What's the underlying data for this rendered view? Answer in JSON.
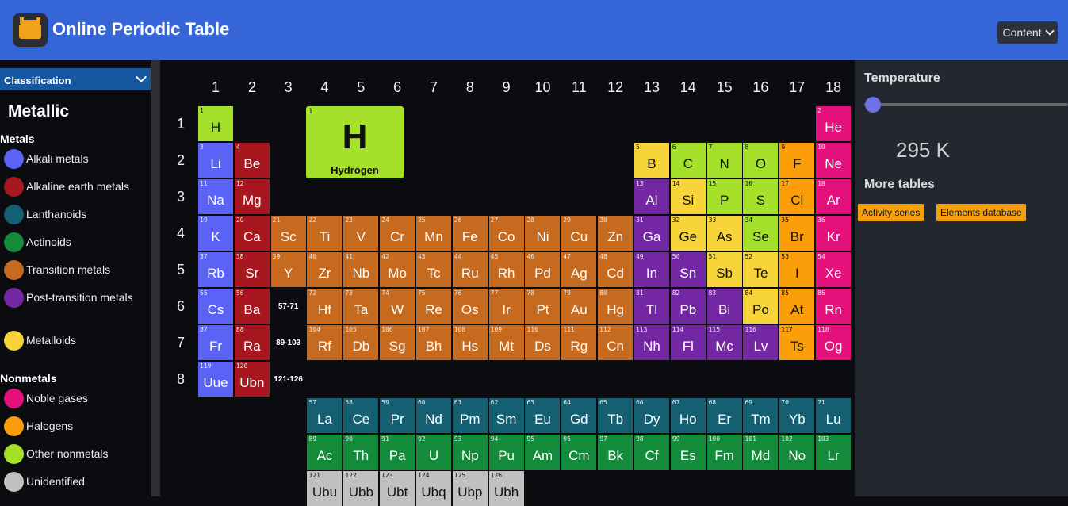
{
  "app": {
    "title": "Online Periodic Table",
    "logo_icon": "periodic-table-logo-icon",
    "content_menu": "Content"
  },
  "sidebar": {
    "classification_select": "Classification",
    "heading": "Metallic",
    "groups": [
      {
        "label": "Metals",
        "items": [
          {
            "label": "Alkali metals",
            "color": "#5a63f5"
          },
          {
            "label": "Alkaline earth metals",
            "color": "#a8171f"
          },
          {
            "label": "Lanthanoids",
            "color": "#155f73"
          },
          {
            "label": "Actinoids",
            "color": "#148a3b"
          },
          {
            "label": "Transition metals",
            "color": "#c56a1f"
          },
          {
            "label": "Post-transition metals",
            "color": "#7427a3"
          },
          {
            "label": "Metalloids",
            "color": "#f7d53a"
          }
        ]
      },
      {
        "label": "Nonmetals",
        "items": [
          {
            "label": "Noble gases",
            "color": "#e4117c"
          },
          {
            "label": "Halogens",
            "color": "#fb9e0a"
          },
          {
            "label": "Other nonmetals",
            "color": "#a5e12a"
          },
          {
            "label": "Unidentified",
            "color": "#c0c0c0"
          }
        ]
      }
    ]
  },
  "table": {
    "group_labels": [
      "1",
      "2",
      "3",
      "4",
      "5",
      "6",
      "7",
      "8",
      "9",
      "10",
      "11",
      "12",
      "13",
      "14",
      "15",
      "16",
      "17",
      "18"
    ],
    "period_labels": [
      "1",
      "2",
      "3",
      "4",
      "5",
      "6",
      "7",
      "8"
    ],
    "range_labels": [
      "57-71",
      "89-103",
      "121-126"
    ],
    "featured": {
      "number": "1",
      "symbol": "H",
      "name": "Hydrogen"
    },
    "category_colors": {
      "alkali": "#5a63f5",
      "alkaline": "#a8171f",
      "lanthanoid": "#155f73",
      "actinoid": "#148a3b",
      "transition": "#c56a1f",
      "post": "#7427a3",
      "metalloid": "#f7d53a",
      "noble": "#e4117c",
      "halogen": "#fb9e0a",
      "nonmetal": "#a5e12a",
      "unknown": "#c0c0c0"
    },
    "elements": [
      {
        "n": "1",
        "s": "H",
        "p": 1,
        "g": 1,
        "c": "nonmetal"
      },
      {
        "n": "2",
        "s": "He",
        "p": 1,
        "g": 18,
        "c": "noble"
      },
      {
        "n": "3",
        "s": "Li",
        "p": 2,
        "g": 1,
        "c": "alkali"
      },
      {
        "n": "4",
        "s": "Be",
        "p": 2,
        "g": 2,
        "c": "alkaline"
      },
      {
        "n": "5",
        "s": "B",
        "p": 2,
        "g": 13,
        "c": "metalloid"
      },
      {
        "n": "6",
        "s": "C",
        "p": 2,
        "g": 14,
        "c": "nonmetal"
      },
      {
        "n": "7",
        "s": "N",
        "p": 2,
        "g": 15,
        "c": "nonmetal"
      },
      {
        "n": "8",
        "s": "O",
        "p": 2,
        "g": 16,
        "c": "nonmetal"
      },
      {
        "n": "9",
        "s": "F",
        "p": 2,
        "g": 17,
        "c": "halogen"
      },
      {
        "n": "10",
        "s": "Ne",
        "p": 2,
        "g": 18,
        "c": "noble"
      },
      {
        "n": "11",
        "s": "Na",
        "p": 3,
        "g": 1,
        "c": "alkali"
      },
      {
        "n": "12",
        "s": "Mg",
        "p": 3,
        "g": 2,
        "c": "alkaline"
      },
      {
        "n": "13",
        "s": "Al",
        "p": 3,
        "g": 13,
        "c": "post"
      },
      {
        "n": "14",
        "s": "Si",
        "p": 3,
        "g": 14,
        "c": "metalloid"
      },
      {
        "n": "15",
        "s": "P",
        "p": 3,
        "g": 15,
        "c": "nonmetal"
      },
      {
        "n": "16",
        "s": "S",
        "p": 3,
        "g": 16,
        "c": "nonmetal"
      },
      {
        "n": "17",
        "s": "Cl",
        "p": 3,
        "g": 17,
        "c": "halogen"
      },
      {
        "n": "18",
        "s": "Ar",
        "p": 3,
        "g": 18,
        "c": "noble"
      },
      {
        "n": "19",
        "s": "K",
        "p": 4,
        "g": 1,
        "c": "alkali"
      },
      {
        "n": "20",
        "s": "Ca",
        "p": 4,
        "g": 2,
        "c": "alkaline"
      },
      {
        "n": "21",
        "s": "Sc",
        "p": 4,
        "g": 3,
        "c": "transition"
      },
      {
        "n": "22",
        "s": "Ti",
        "p": 4,
        "g": 4,
        "c": "transition"
      },
      {
        "n": "23",
        "s": "V",
        "p": 4,
        "g": 5,
        "c": "transition"
      },
      {
        "n": "24",
        "s": "Cr",
        "p": 4,
        "g": 6,
        "c": "transition"
      },
      {
        "n": "25",
        "s": "Mn",
        "p": 4,
        "g": 7,
        "c": "transition"
      },
      {
        "n": "26",
        "s": "Fe",
        "p": 4,
        "g": 8,
        "c": "transition"
      },
      {
        "n": "27",
        "s": "Co",
        "p": 4,
        "g": 9,
        "c": "transition"
      },
      {
        "n": "28",
        "s": "Ni",
        "p": 4,
        "g": 10,
        "c": "transition"
      },
      {
        "n": "29",
        "s": "Cu",
        "p": 4,
        "g": 11,
        "c": "transition"
      },
      {
        "n": "30",
        "s": "Zn",
        "p": 4,
        "g": 12,
        "c": "transition"
      },
      {
        "n": "31",
        "s": "Ga",
        "p": 4,
        "g": 13,
        "c": "post"
      },
      {
        "n": "32",
        "s": "Ge",
        "p": 4,
        "g": 14,
        "c": "metalloid"
      },
      {
        "n": "33",
        "s": "As",
        "p": 4,
        "g": 15,
        "c": "metalloid"
      },
      {
        "n": "34",
        "s": "Se",
        "p": 4,
        "g": 16,
        "c": "nonmetal"
      },
      {
        "n": "35",
        "s": "Br",
        "p": 4,
        "g": 17,
        "c": "halogen"
      },
      {
        "n": "36",
        "s": "Kr",
        "p": 4,
        "g": 18,
        "c": "noble"
      },
      {
        "n": "37",
        "s": "Rb",
        "p": 5,
        "g": 1,
        "c": "alkali"
      },
      {
        "n": "38",
        "s": "Sr",
        "p": 5,
        "g": 2,
        "c": "alkaline"
      },
      {
        "n": "39",
        "s": "Y",
        "p": 5,
        "g": 3,
        "c": "transition"
      },
      {
        "n": "40",
        "s": "Zr",
        "p": 5,
        "g": 4,
        "c": "transition"
      },
      {
        "n": "41",
        "s": "Nb",
        "p": 5,
        "g": 5,
        "c": "transition"
      },
      {
        "n": "42",
        "s": "Mo",
        "p": 5,
        "g": 6,
        "c": "transition"
      },
      {
        "n": "43",
        "s": "Tc",
        "p": 5,
        "g": 7,
        "c": "transition"
      },
      {
        "n": "44",
        "s": "Ru",
        "p": 5,
        "g": 8,
        "c": "transition"
      },
      {
        "n": "45",
        "s": "Rh",
        "p": 5,
        "g": 9,
        "c": "transition"
      },
      {
        "n": "46",
        "s": "Pd",
        "p": 5,
        "g": 10,
        "c": "transition"
      },
      {
        "n": "47",
        "s": "Ag",
        "p": 5,
        "g": 11,
        "c": "transition"
      },
      {
        "n": "48",
        "s": "Cd",
        "p": 5,
        "g": 12,
        "c": "transition"
      },
      {
        "n": "49",
        "s": "In",
        "p": 5,
        "g": 13,
        "c": "post"
      },
      {
        "n": "50",
        "s": "Sn",
        "p": 5,
        "g": 14,
        "c": "post"
      },
      {
        "n": "51",
        "s": "Sb",
        "p": 5,
        "g": 15,
        "c": "metalloid"
      },
      {
        "n": "52",
        "s": "Te",
        "p": 5,
        "g": 16,
        "c": "metalloid"
      },
      {
        "n": "53",
        "s": "I",
        "p": 5,
        "g": 17,
        "c": "halogen"
      },
      {
        "n": "54",
        "s": "Xe",
        "p": 5,
        "g": 18,
        "c": "noble"
      },
      {
        "n": "55",
        "s": "Cs",
        "p": 6,
        "g": 1,
        "c": "alkali"
      },
      {
        "n": "56",
        "s": "Ba",
        "p": 6,
        "g": 2,
        "c": "alkaline"
      },
      {
        "n": "72",
        "s": "Hf",
        "p": 6,
        "g": 4,
        "c": "transition"
      },
      {
        "n": "73",
        "s": "Ta",
        "p": 6,
        "g": 5,
        "c": "transition"
      },
      {
        "n": "74",
        "s": "W",
        "p": 6,
        "g": 6,
        "c": "transition"
      },
      {
        "n": "75",
        "s": "Re",
        "p": 6,
        "g": 7,
        "c": "transition"
      },
      {
        "n": "76",
        "s": "Os",
        "p": 6,
        "g": 8,
        "c": "transition"
      },
      {
        "n": "77",
        "s": "Ir",
        "p": 6,
        "g": 9,
        "c": "transition"
      },
      {
        "n": "78",
        "s": "Pt",
        "p": 6,
        "g": 10,
        "c": "transition"
      },
      {
        "n": "79",
        "s": "Au",
        "p": 6,
        "g": 11,
        "c": "transition"
      },
      {
        "n": "80",
        "s": "Hg",
        "p": 6,
        "g": 12,
        "c": "transition"
      },
      {
        "n": "81",
        "s": "Tl",
        "p": 6,
        "g": 13,
        "c": "post"
      },
      {
        "n": "82",
        "s": "Pb",
        "p": 6,
        "g": 14,
        "c": "post"
      },
      {
        "n": "83",
        "s": "Bi",
        "p": 6,
        "g": 15,
        "c": "post"
      },
      {
        "n": "84",
        "s": "Po",
        "p": 6,
        "g": 16,
        "c": "metalloid"
      },
      {
        "n": "85",
        "s": "At",
        "p": 6,
        "g": 17,
        "c": "halogen"
      },
      {
        "n": "86",
        "s": "Rn",
        "p": 6,
        "g": 18,
        "c": "noble"
      },
      {
        "n": "87",
        "s": "Fr",
        "p": 7,
        "g": 1,
        "c": "alkali"
      },
      {
        "n": "88",
        "s": "Ra",
        "p": 7,
        "g": 2,
        "c": "alkaline"
      },
      {
        "n": "104",
        "s": "Rf",
        "p": 7,
        "g": 4,
        "c": "transition"
      },
      {
        "n": "105",
        "s": "Db",
        "p": 7,
        "g": 5,
        "c": "transition"
      },
      {
        "n": "106",
        "s": "Sg",
        "p": 7,
        "g": 6,
        "c": "transition"
      },
      {
        "n": "107",
        "s": "Bh",
        "p": 7,
        "g": 7,
        "c": "transition"
      },
      {
        "n": "108",
        "s": "Hs",
        "p": 7,
        "g": 8,
        "c": "transition"
      },
      {
        "n": "109",
        "s": "Mt",
        "p": 7,
        "g": 9,
        "c": "transition"
      },
      {
        "n": "110",
        "s": "Ds",
        "p": 7,
        "g": 10,
        "c": "transition"
      },
      {
        "n": "111",
        "s": "Rg",
        "p": 7,
        "g": 11,
        "c": "transition"
      },
      {
        "n": "112",
        "s": "Cn",
        "p": 7,
        "g": 12,
        "c": "transition"
      },
      {
        "n": "113",
        "s": "Nh",
        "p": 7,
        "g": 13,
        "c": "post"
      },
      {
        "n": "114",
        "s": "Fl",
        "p": 7,
        "g": 14,
        "c": "post"
      },
      {
        "n": "115",
        "s": "Mc",
        "p": 7,
        "g": 15,
        "c": "post"
      },
      {
        "n": "116",
        "s": "Lv",
        "p": 7,
        "g": 16,
        "c": "post"
      },
      {
        "n": "117",
        "s": "Ts",
        "p": 7,
        "g": 17,
        "c": "halogen"
      },
      {
        "n": "118",
        "s": "Og",
        "p": 7,
        "g": 18,
        "c": "noble"
      },
      {
        "n": "119",
        "s": "Uue",
        "p": 8,
        "g": 1,
        "c": "alkali"
      },
      {
        "n": "120",
        "s": "Ubn",
        "p": 8,
        "g": 2,
        "c": "alkaline"
      },
      {
        "n": "57",
        "s": "La",
        "p": 9,
        "g": 4,
        "c": "lanthanoid"
      },
      {
        "n": "58",
        "s": "Ce",
        "p": 9,
        "g": 5,
        "c": "lanthanoid"
      },
      {
        "n": "59",
        "s": "Pr",
        "p": 9,
        "g": 6,
        "c": "lanthanoid"
      },
      {
        "n": "60",
        "s": "Nd",
        "p": 9,
        "g": 7,
        "c": "lanthanoid"
      },
      {
        "n": "61",
        "s": "Pm",
        "p": 9,
        "g": 8,
        "c": "lanthanoid"
      },
      {
        "n": "62",
        "s": "Sm",
        "p": 9,
        "g": 9,
        "c": "lanthanoid"
      },
      {
        "n": "63",
        "s": "Eu",
        "p": 9,
        "g": 10,
        "c": "lanthanoid"
      },
      {
        "n": "64",
        "s": "Gd",
        "p": 9,
        "g": 11,
        "c": "lanthanoid"
      },
      {
        "n": "65",
        "s": "Tb",
        "p": 9,
        "g": 12,
        "c": "lanthanoid"
      },
      {
        "n": "66",
        "s": "Dy",
        "p": 9,
        "g": 13,
        "c": "lanthanoid"
      },
      {
        "n": "67",
        "s": "Ho",
        "p": 9,
        "g": 14,
        "c": "lanthanoid"
      },
      {
        "n": "68",
        "s": "Er",
        "p": 9,
        "g": 15,
        "c": "lanthanoid"
      },
      {
        "n": "69",
        "s": "Tm",
        "p": 9,
        "g": 16,
        "c": "lanthanoid"
      },
      {
        "n": "70",
        "s": "Yb",
        "p": 9,
        "g": 17,
        "c": "lanthanoid"
      },
      {
        "n": "71",
        "s": "Lu",
        "p": 9,
        "g": 18,
        "c": "lanthanoid"
      },
      {
        "n": "89",
        "s": "Ac",
        "p": 10,
        "g": 4,
        "c": "actinoid"
      },
      {
        "n": "90",
        "s": "Th",
        "p": 10,
        "g": 5,
        "c": "actinoid"
      },
      {
        "n": "91",
        "s": "Pa",
        "p": 10,
        "g": 6,
        "c": "actinoid"
      },
      {
        "n": "92",
        "s": "U",
        "p": 10,
        "g": 7,
        "c": "actinoid"
      },
      {
        "n": "93",
        "s": "Np",
        "p": 10,
        "g": 8,
        "c": "actinoid"
      },
      {
        "n": "94",
        "s": "Pu",
        "p": 10,
        "g": 9,
        "c": "actinoid"
      },
      {
        "n": "95",
        "s": "Am",
        "p": 10,
        "g": 10,
        "c": "actinoid"
      },
      {
        "n": "96",
        "s": "Cm",
        "p": 10,
        "g": 11,
        "c": "actinoid"
      },
      {
        "n": "97",
        "s": "Bk",
        "p": 10,
        "g": 12,
        "c": "actinoid"
      },
      {
        "n": "98",
        "s": "Cf",
        "p": 10,
        "g": 13,
        "c": "actinoid"
      },
      {
        "n": "99",
        "s": "Es",
        "p": 10,
        "g": 14,
        "c": "actinoid"
      },
      {
        "n": "100",
        "s": "Fm",
        "p": 10,
        "g": 15,
        "c": "actinoid"
      },
      {
        "n": "101",
        "s": "Md",
        "p": 10,
        "g": 16,
        "c": "actinoid"
      },
      {
        "n": "102",
        "s": "No",
        "p": 10,
        "g": 17,
        "c": "actinoid"
      },
      {
        "n": "103",
        "s": "Lr",
        "p": 10,
        "g": 18,
        "c": "actinoid"
      },
      {
        "n": "121",
        "s": "Ubu",
        "p": 11,
        "g": 4,
        "c": "unknown"
      },
      {
        "n": "122",
        "s": "Ubb",
        "p": 11,
        "g": 5,
        "c": "unknown"
      },
      {
        "n": "123",
        "s": "Ubt",
        "p": 11,
        "g": 6,
        "c": "unknown"
      },
      {
        "n": "124",
        "s": "Ubq",
        "p": 11,
        "g": 7,
        "c": "unknown"
      },
      {
        "n": "125",
        "s": "Ubp",
        "p": 11,
        "g": 8,
        "c": "unknown"
      },
      {
        "n": "126",
        "s": "Ubh",
        "p": 11,
        "g": 9,
        "c": "unknown"
      }
    ]
  },
  "right_panel": {
    "temperature_heading": "Temperature",
    "temperature_value": "295 K",
    "slider_fraction": 0.0,
    "more_tables_heading": "More tables",
    "links": [
      "Activity series",
      "Elements database"
    ]
  }
}
